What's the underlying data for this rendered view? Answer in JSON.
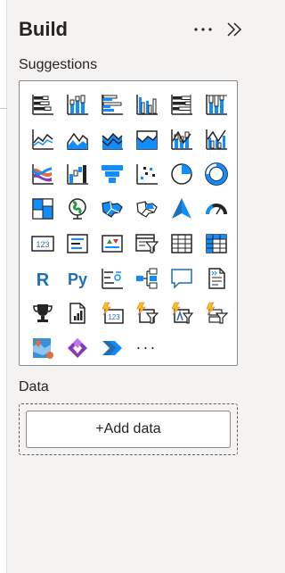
{
  "panel": {
    "title": "Build",
    "more_options": "···",
    "collapse_icon": "double-chevron-right-icon"
  },
  "suggestions": {
    "label": "Suggestions",
    "more_visuals": "···",
    "visuals": [
      {
        "icon": "stacked-bar-chart-icon"
      },
      {
        "icon": "stacked-column-chart-icon"
      },
      {
        "icon": "clustered-bar-chart-icon"
      },
      {
        "icon": "clustered-column-chart-icon"
      },
      {
        "icon": "100-stacked-bar-chart-icon"
      },
      {
        "icon": "100-stacked-column-chart-icon"
      },
      {
        "icon": "line-chart-icon"
      },
      {
        "icon": "area-chart-icon"
      },
      {
        "icon": "stacked-area-chart-icon"
      },
      {
        "icon": "100-stacked-area-chart-icon"
      },
      {
        "icon": "line-and-stacked-column-chart-icon"
      },
      {
        "icon": "line-and-clustered-column-chart-icon"
      },
      {
        "icon": "ribbon-chart-icon"
      },
      {
        "icon": "waterfall-chart-icon"
      },
      {
        "icon": "funnel-chart-icon"
      },
      {
        "icon": "scatter-chart-icon"
      },
      {
        "icon": "pie-chart-icon"
      },
      {
        "icon": "donut-chart-icon"
      },
      {
        "icon": "treemap-icon"
      },
      {
        "icon": "map-globe-icon"
      },
      {
        "icon": "filled-map-icon"
      },
      {
        "icon": "shape-map-icon"
      },
      {
        "icon": "azure-map-icon"
      },
      {
        "icon": "gauge-icon"
      },
      {
        "icon": "card-icon"
      },
      {
        "icon": "multi-row-card-icon"
      },
      {
        "icon": "kpi-icon"
      },
      {
        "icon": "slicer-icon"
      },
      {
        "icon": "table-icon"
      },
      {
        "icon": "matrix-icon"
      },
      {
        "icon": "r-script-visual-icon"
      },
      {
        "icon": "python-visual-icon"
      },
      {
        "icon": "key-influencers-icon"
      },
      {
        "icon": "decomposition-tree-icon"
      },
      {
        "icon": "qa-chat-icon"
      },
      {
        "icon": "smart-narrative-icon"
      },
      {
        "icon": "metrics-trophy-icon"
      },
      {
        "icon": "paginated-report-icon"
      },
      {
        "icon": "power-card-icon"
      },
      {
        "icon": "power-slicer-icon"
      },
      {
        "icon": "power-text-slicer-icon"
      },
      {
        "icon": "power-button-slicer-icon"
      },
      {
        "icon": "arcgis-map-icon"
      },
      {
        "icon": "power-apps-icon"
      },
      {
        "icon": "power-automate-icon"
      }
    ],
    "r_label": "R",
    "py_label": "Py",
    "card_text": "123"
  },
  "data": {
    "label": "Data",
    "add_button": "+Add data"
  },
  "colors": {
    "blue": "#118dff",
    "dark_blue": "#1f6fb5",
    "accent_blue": "#3a8fd9",
    "dark": "#252423",
    "gray": "#605e5c",
    "yellow": "#f2c811",
    "orange": "#e66c37",
    "purple": "#8a3ab9",
    "green": "#2b9a3e"
  }
}
